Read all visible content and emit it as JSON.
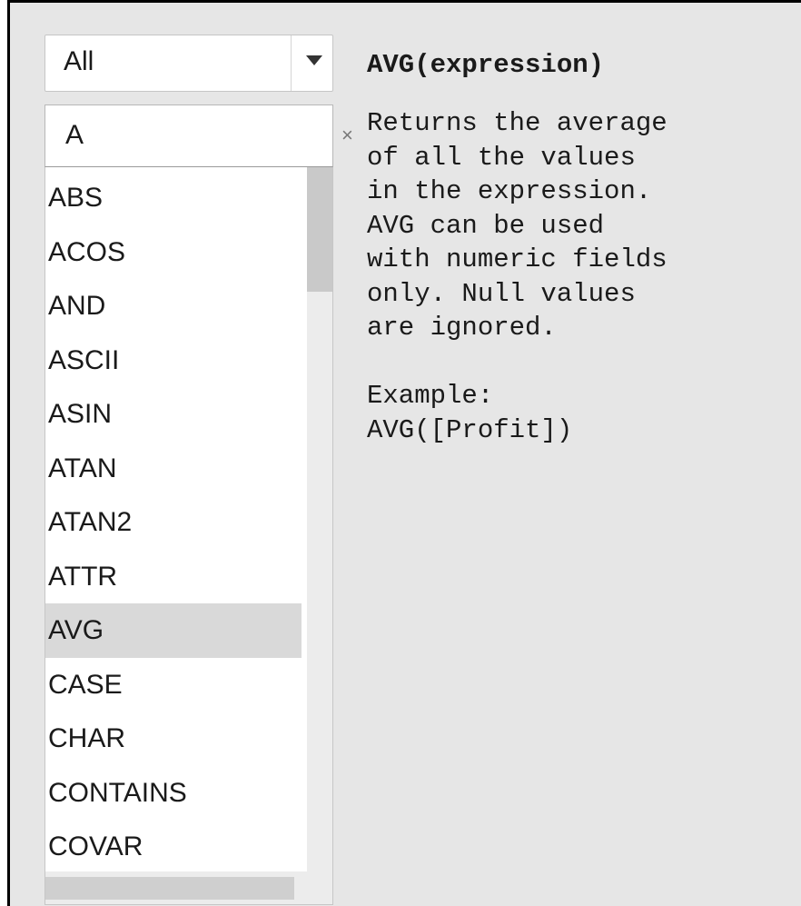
{
  "category_filter": {
    "selected": "All"
  },
  "search": {
    "value": "A",
    "clear_glyph": "×"
  },
  "functions": [
    "ABS",
    "ACOS",
    "AND",
    "ASCII",
    "ASIN",
    "ATAN",
    "ATAN2",
    "ATTR",
    "AVG",
    "CASE",
    "CHAR",
    "CONTAINS",
    "COVAR"
  ],
  "selected_function": "AVG",
  "description": {
    "signature": "AVG(expression)",
    "lines": [
      "Returns the average",
      "of all the values",
      "in the expression.",
      "AVG can be used",
      "with numeric fields",
      "only. Null values",
      "are ignored."
    ],
    "example_label": "Example:",
    "example_code": "AVG([Profit])"
  },
  "colors": {
    "panel_background": "#e6e6e6",
    "selected_row": "#d9d9d9",
    "scroll_thumb": "#c9c9c9"
  }
}
